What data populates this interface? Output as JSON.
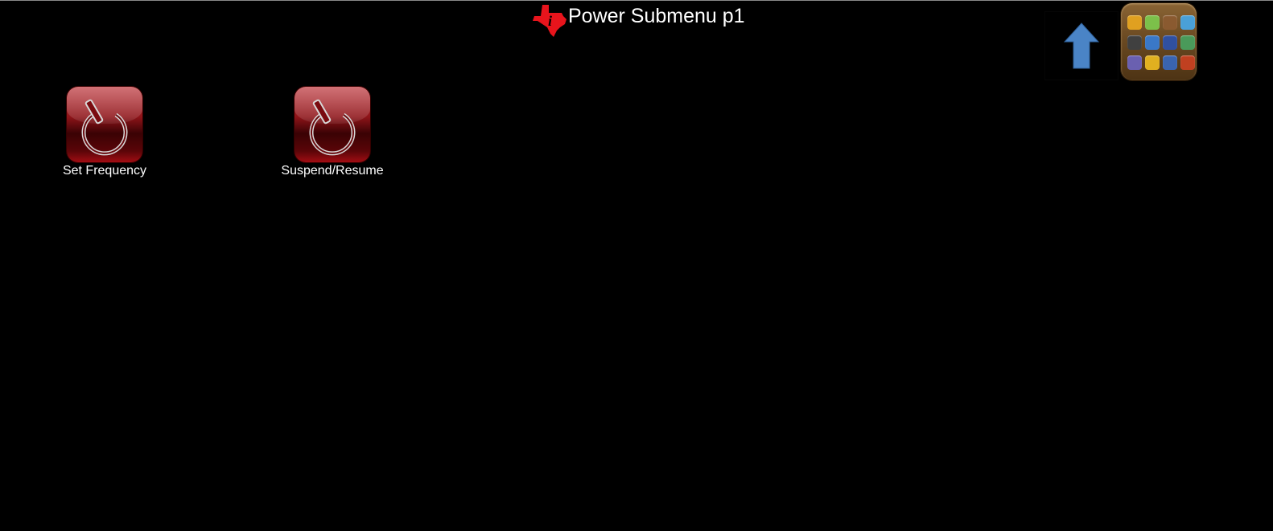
{
  "header": {
    "title": "Power Submenu p1",
    "logo_icon": "texas-instruments-logo"
  },
  "nav": {
    "up_icon": "arrow-up-icon",
    "apps_icon": "app-grid-icon",
    "apps_tile_colors": [
      "#e0a020",
      "#7cc04a",
      "#8a5a30",
      "#4aa0d8",
      "#404040",
      "#3a78c8",
      "#3050a0",
      "#4a9a5a",
      "#6a60b0",
      "#e0b020",
      "#3a64b0",
      "#c04020"
    ]
  },
  "tiles": [
    {
      "label": "Set Frequency",
      "icon": "power-icon"
    },
    {
      "label": "Suspend/Resume",
      "icon": "power-icon"
    }
  ],
  "colors": {
    "background": "#000000",
    "accent_red": "#b8262c",
    "arrow_blue": "#4a84c6",
    "logo_red": "#e8141c"
  }
}
